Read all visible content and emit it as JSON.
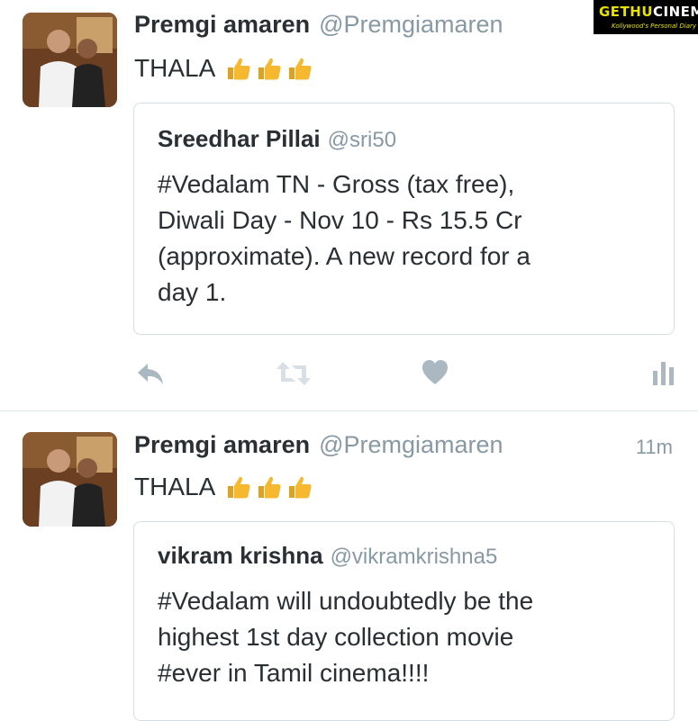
{
  "watermark": {
    "brand_part1": "GETHU",
    "brand_part2": "CINEMA",
    "tagline": "Kollywood's Personal Diary"
  },
  "tweets": [
    {
      "author_name": "Premgi amaren",
      "author_handle": "@Premgiamaren",
      "timestamp": "",
      "text": "THALA",
      "emoji": [
        "thumbs-up",
        "thumbs-up",
        "thumbs-up"
      ],
      "quoted": {
        "author_name": "Sreedhar Pillai",
        "author_handle": "@sri50",
        "text_lines": [
          "#Vedalam TN - Gross (tax free),",
          "Diwali Day - Nov 10 - Rs 15.5 Cr",
          "(approximate). A new record for a",
          "day 1."
        ]
      },
      "actions": [
        "reply-icon",
        "retweet-icon",
        "like-icon",
        "analytics-icon"
      ]
    },
    {
      "author_name": "Premgi amaren",
      "author_handle": "@Premgiamaren",
      "timestamp": "11m",
      "text": "THALA",
      "emoji": [
        "thumbs-up",
        "thumbs-up",
        "thumbs-up"
      ],
      "quoted": {
        "author_name": "vikram krishna",
        "author_handle": "@vikramkrishna5",
        "text_lines": [
          "#Vedalam will undoubtedly be the",
          "highest 1st day collection movie",
          "#ever in Tamil cinema!!!!"
        ]
      }
    }
  ],
  "colors": {
    "text": "#292f33",
    "muted": "#8899a6",
    "action_gray": "#aab8c2",
    "border": "#d6dde3",
    "emoji": "#f5b82e"
  }
}
